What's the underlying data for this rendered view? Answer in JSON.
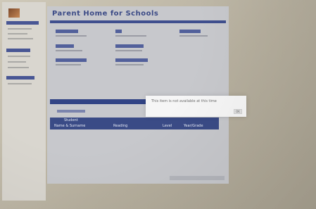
{
  "app": {
    "title": "Parent Home for Schools"
  },
  "table": {
    "header_row1": "Student",
    "col1": "Name & Surname",
    "col2": "Reading",
    "col3": "Level",
    "col4": "Year/Grade"
  },
  "dialog": {
    "message": "This item is not available at this time",
    "ok_label": "OK"
  }
}
